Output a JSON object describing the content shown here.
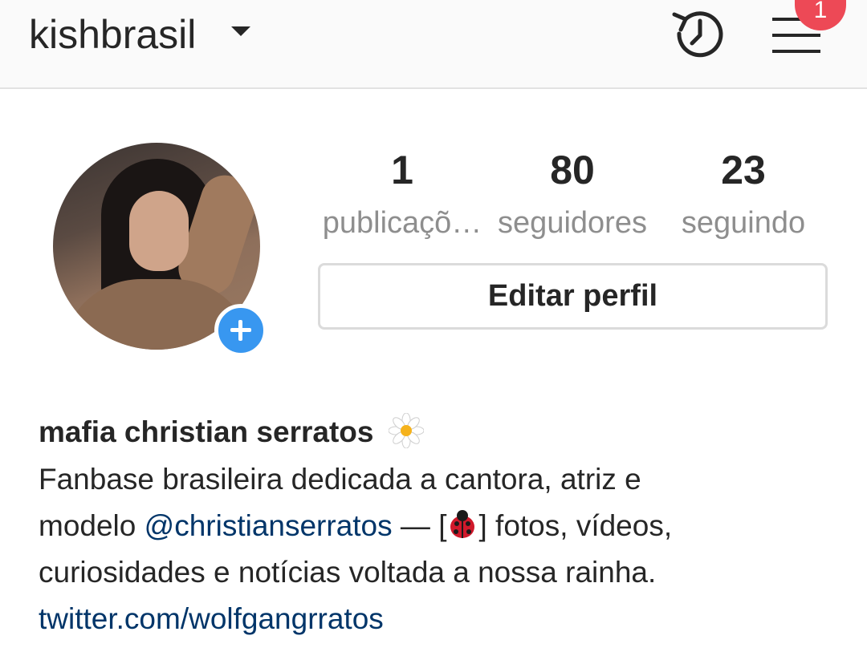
{
  "header": {
    "username": "kishbrasil",
    "notification_count": "1"
  },
  "stats": {
    "posts": {
      "value": "1",
      "label": "publicaçõ…"
    },
    "followers": {
      "value": "80",
      "label": "seguidores"
    },
    "following": {
      "value": "23",
      "label": "seguindo"
    }
  },
  "edit_profile_label": "Editar perfil",
  "bio": {
    "name": "mafia christian serratos",
    "line1_before": "Fanbase brasileira dedicada a cantora, atriz e",
    "line2_before": "modelo ",
    "mention": "@christianserratos",
    "line2_middle": " — [",
    "line2_after": "] fotos, vídeos,",
    "line3": "curiosidades e notícias voltada a nossa rainha.",
    "link": "twitter.com/wolfgangrratos"
  },
  "colors": {
    "accent_blue": "#3897f0",
    "badge_red": "#ed4956",
    "link_blue": "#003569"
  },
  "icons": [
    "caret-down-icon",
    "history-icon",
    "menu-icon",
    "plus-icon",
    "daisy-emoji",
    "ladybug-emoji"
  ]
}
